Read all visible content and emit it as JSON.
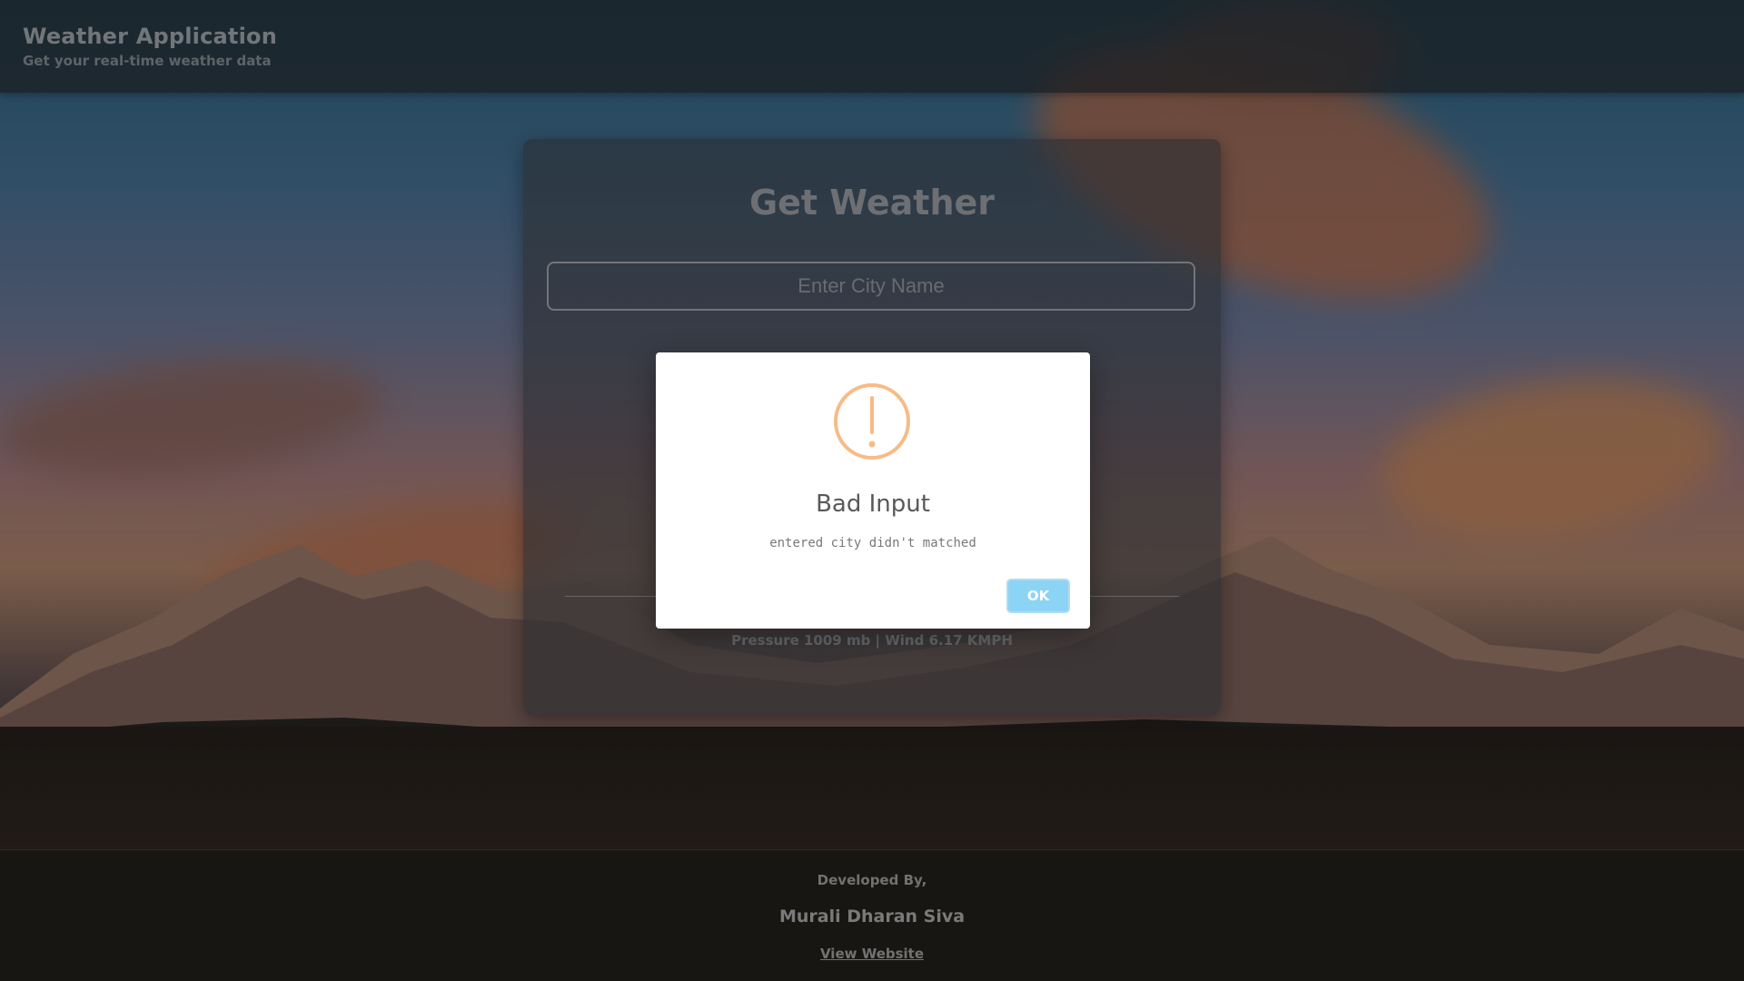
{
  "header": {
    "title": "Weather Application",
    "subtitle": "Get your real-time weather data"
  },
  "card": {
    "heading": "Get Weather",
    "city_input": {
      "value": "",
      "placeholder": "Enter City Name"
    },
    "details": "Pressure 1009 mb | Wind 6.17 KMPH"
  },
  "modal": {
    "icon": "warning-icon",
    "title": "Bad Input",
    "message": "entered city didn't matched",
    "ok_label": "OK"
  },
  "footer": {
    "developed_by": "Developed By,",
    "developer_name": "Murali Dharan Siva",
    "website_link": "View Website"
  },
  "colors": {
    "warning_accent": "#f8bb86",
    "ok_button": "#8cd4f5",
    "topbar_background": "#2b333a"
  }
}
